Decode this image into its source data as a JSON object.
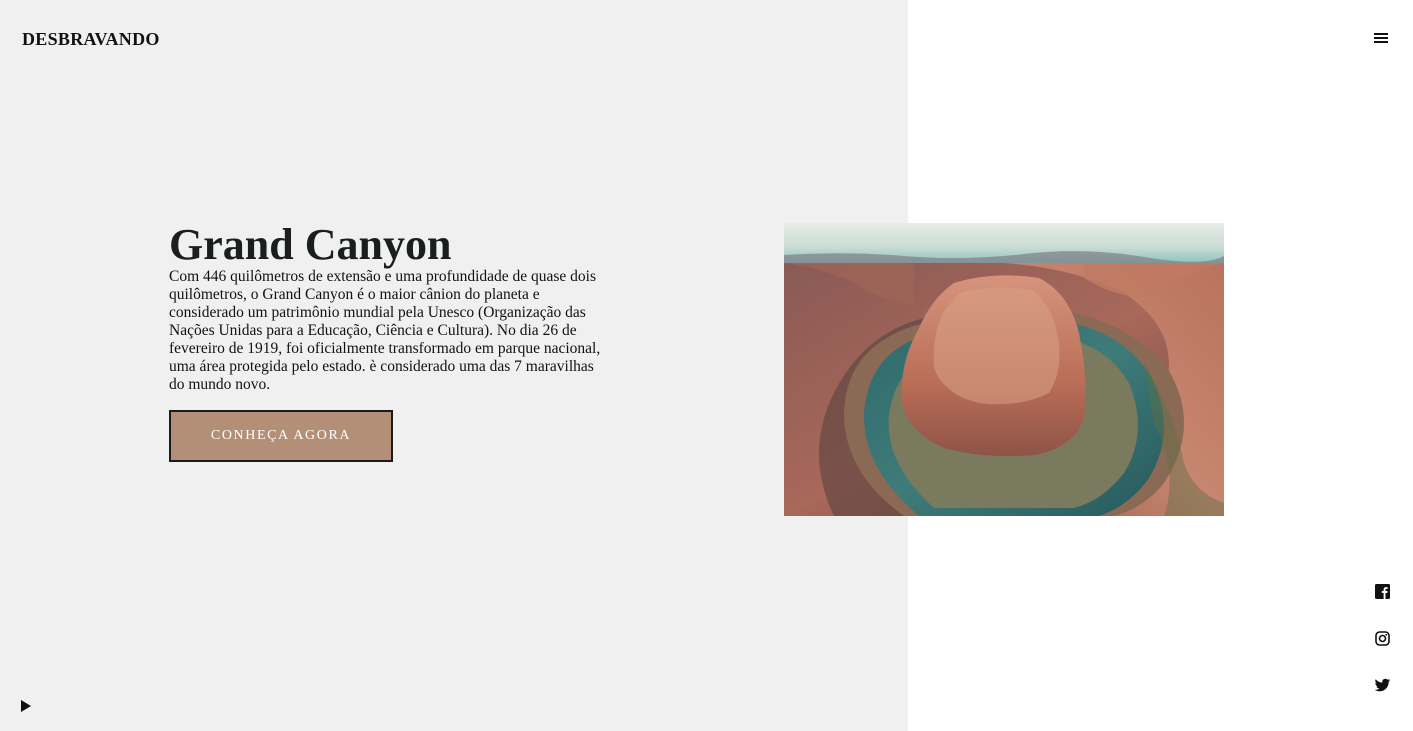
{
  "header": {
    "logo": "DESBRAVANDO",
    "menu_icon": "hamburger-menu-icon"
  },
  "hero": {
    "title": "Grand Canyon",
    "description": "Com 446 quilômetros de extensão e uma profundidade de quase dois quilômetros, o Grand Canyon é o maior cânion do planeta e considerado um patrimônio mundial pela Unesco (Organização das Nações Unidas para a Educação, Ciência e Cultura). No dia 26 de fevereiro de 1919, foi oficialmente transformado em parque nacional, uma área protegida pelo estado. è considerado uma das 7 maravilhas do mundo novo.",
    "cta_label": "CONHEÇA AGORA",
    "image_subject": "horseshoe-bend-canyon-photo"
  },
  "social": [
    {
      "name": "facebook",
      "icon": "facebook-icon"
    },
    {
      "name": "instagram",
      "icon": "instagram-icon"
    },
    {
      "name": "twitter",
      "icon": "twitter-icon"
    }
  ],
  "player": {
    "icon": "play-icon"
  },
  "colors": {
    "left_panel_bg": "#f0f0f0",
    "page_bg": "#ffffff",
    "cta_bg": "#b48f78",
    "cta_border": "#1b1b1b",
    "text": "#111111"
  }
}
